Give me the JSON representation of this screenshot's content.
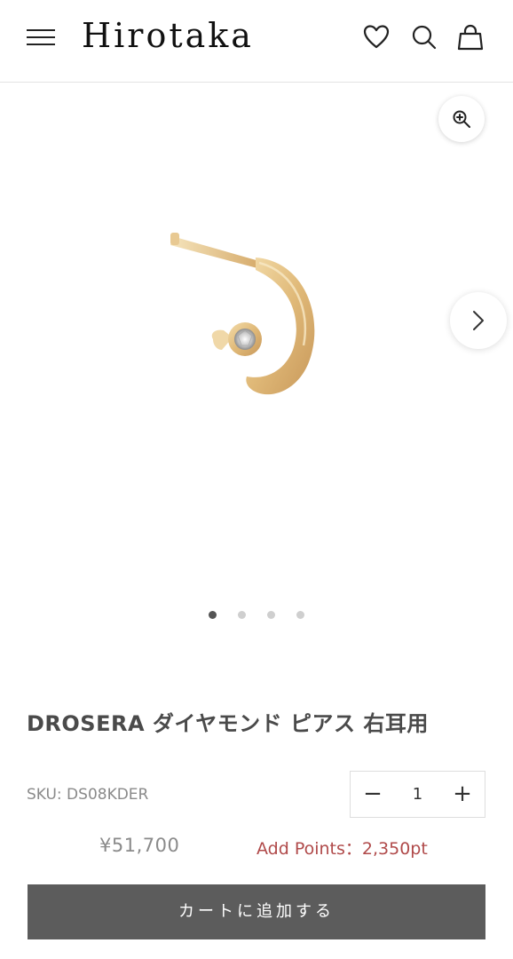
{
  "header": {
    "logo": "Hirotaka",
    "menu_icon": "hamburger-menu-icon",
    "wishlist_icon": "heart-icon",
    "search_icon": "search-icon",
    "cart_icon": "shopping-bag-icon"
  },
  "gallery": {
    "zoom_icon": "zoom-in-icon",
    "next_icon": "chevron-right-icon",
    "image_alt": "DROSERA ダイヤモンド ピアス 右耳用",
    "slide_count": 4,
    "active_slide": 1
  },
  "product": {
    "title": "DROSERA ダイヤモンド ピアス 右耳用",
    "sku": "SKU: DS08KDER",
    "price": "¥51,700",
    "points": "Add Points：2,350pt",
    "quantity": "1",
    "qty_minus": "−",
    "qty_plus": "+",
    "add_to_cart": "カートに追加する"
  },
  "colors": {
    "button_bg": "#5c5c5c",
    "points_text": "#b04a4a",
    "dot_active": "#555555",
    "dot_inactive": "#cfcfcf"
  }
}
